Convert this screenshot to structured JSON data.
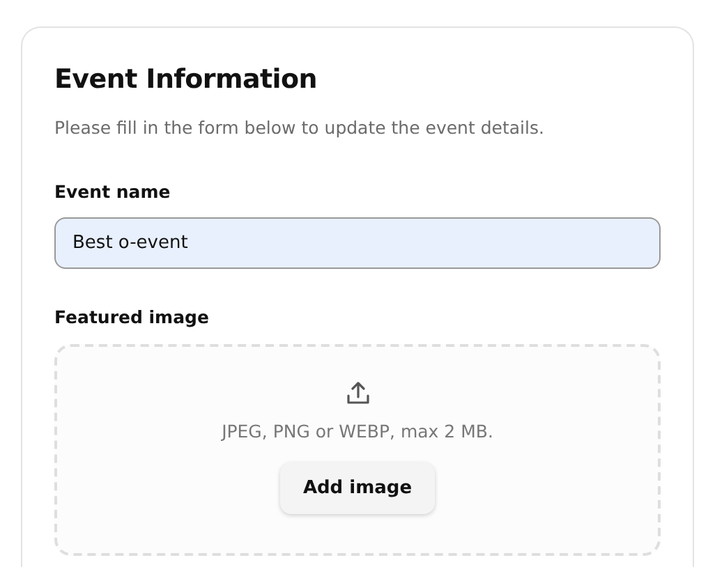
{
  "card": {
    "title": "Event Information",
    "subtitle": "Please fill in the form below to update the event details."
  },
  "event_name": {
    "label": "Event name",
    "value": "Best o-event"
  },
  "featured_image": {
    "label": "Featured image",
    "hint": "JPEG, PNG or WEBP, max 2 MB.",
    "button": "Add image"
  }
}
